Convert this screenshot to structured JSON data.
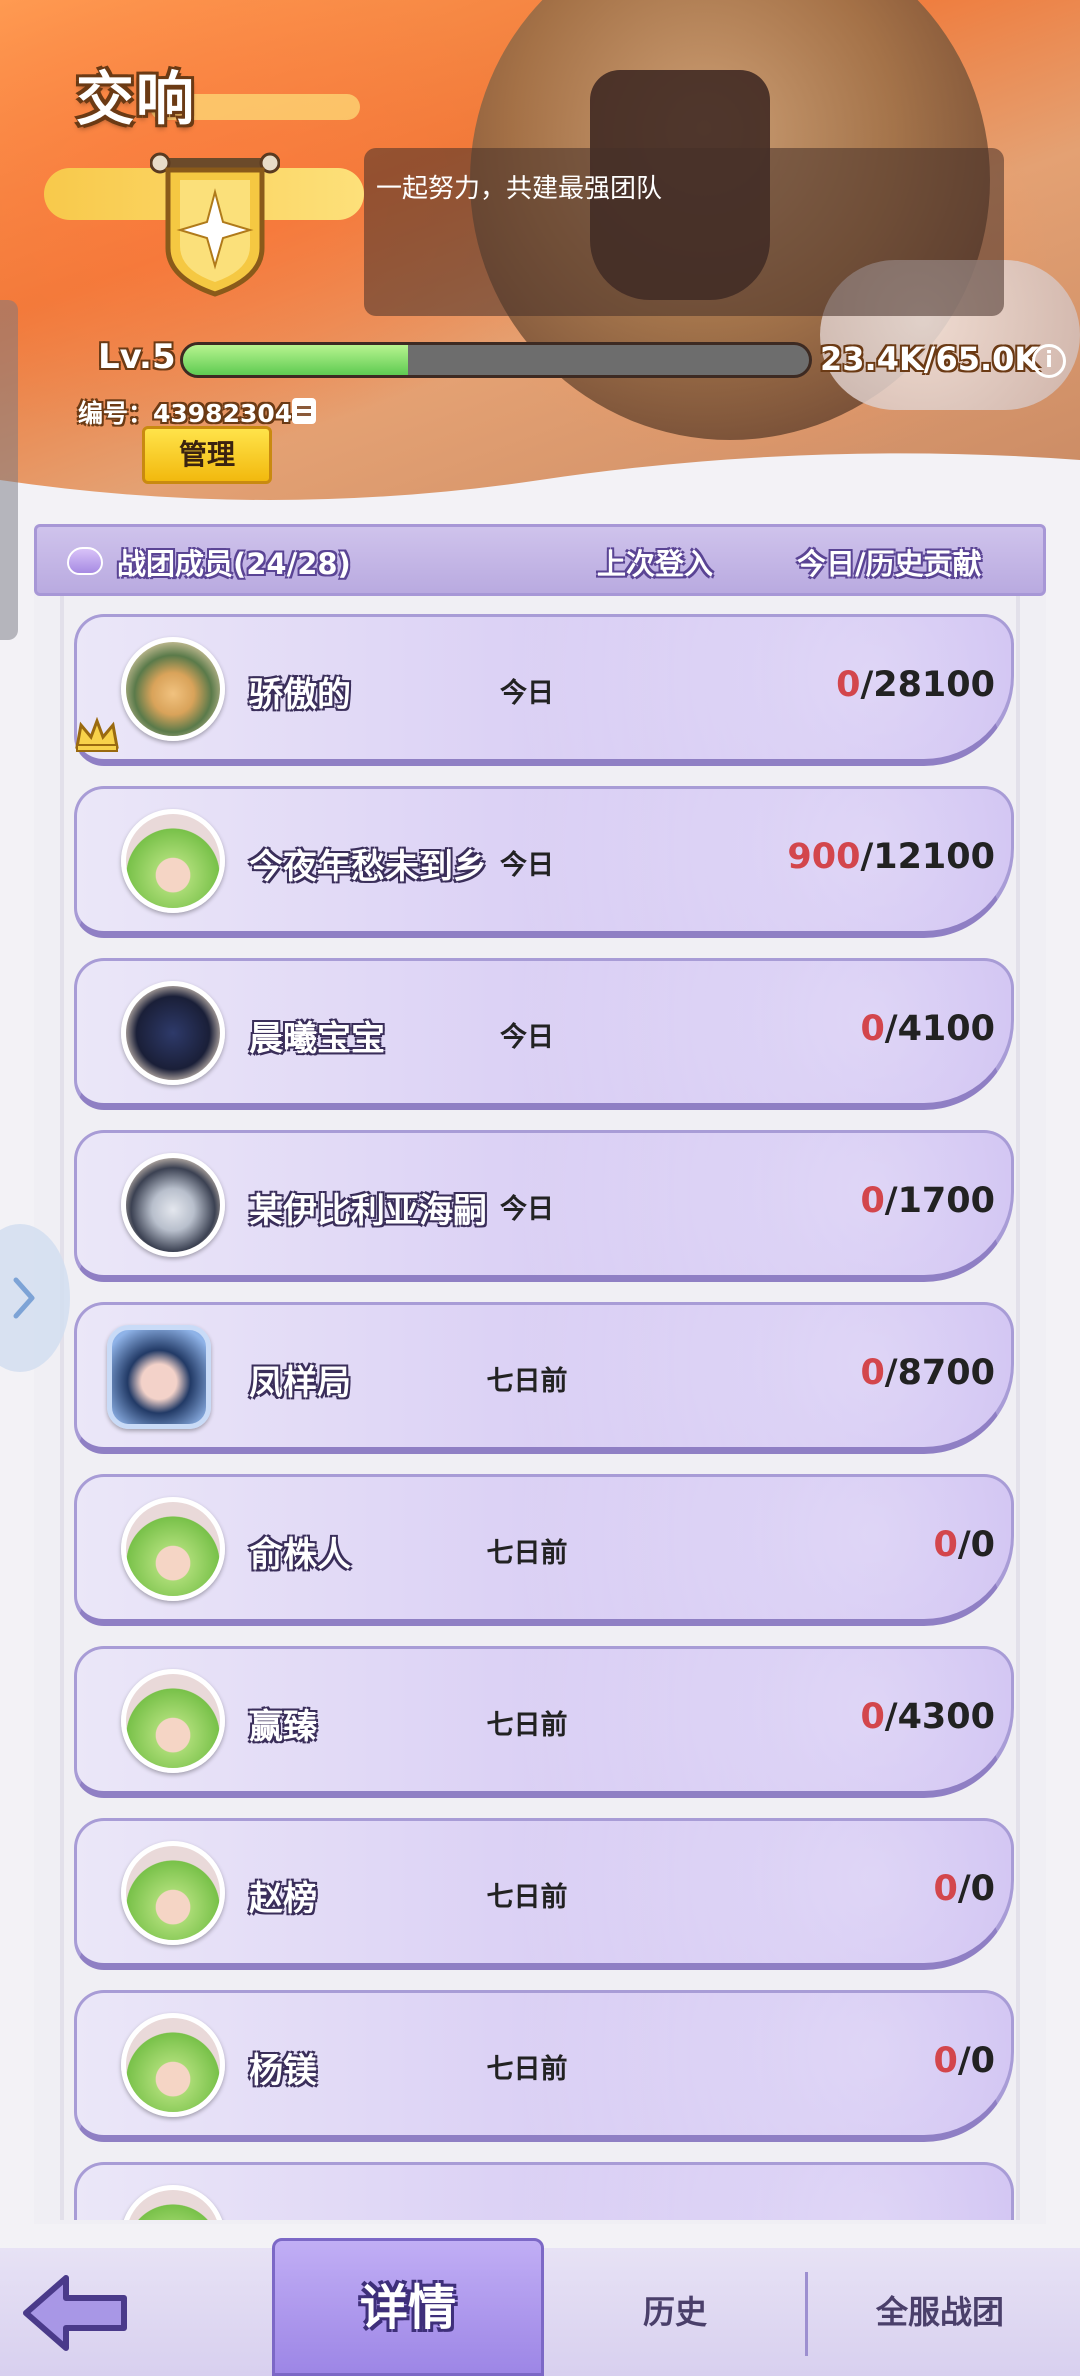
{
  "header": {
    "guild_name": "交响",
    "motto": "一起努力，共建最强团队",
    "level": "Lv.5",
    "progress_text": "23.4K/65.0K",
    "progress_value": 0.36,
    "guild_id": "编号：43982304",
    "manage_label": "管理"
  },
  "members_panel": {
    "title": "战团成员(24/28)",
    "col_last_login": "上次登入",
    "col_contribution": "今日/历史贡献",
    "members": [
      {
        "name": "骄傲的",
        "last_login": "今日",
        "today": "0",
        "total": "/28100",
        "avatar": "knight-avatar",
        "crown": true
      },
      {
        "name": "今夜年愁未到乡",
        "last_login": "今日",
        "today": "900",
        "total": "/12100",
        "avatar": "green-hair-avatar"
      },
      {
        "name": "晨曦宝宝",
        "last_login": "今日",
        "today": "0",
        "total": "/4100",
        "avatar": "robot-avatar"
      },
      {
        "name": "某伊比利亚海嗣",
        "last_login": "今日",
        "today": "0",
        "total": "/1700",
        "avatar": "hooded-avatar"
      },
      {
        "name": "凤样局",
        "last_login": "七日前",
        "today": "0",
        "total": "/8700",
        "avatar": "blue-hair-avatar"
      },
      {
        "name": "俞株人",
        "last_login": "七日前",
        "today": "0",
        "total": "/0",
        "avatar": "green-hair-avatar"
      },
      {
        "name": "赢臻",
        "last_login": "七日前",
        "today": "0",
        "total": "/4300",
        "avatar": "green-hair-avatar"
      },
      {
        "name": "赵榜",
        "last_login": "七日前",
        "today": "0",
        "total": "/0",
        "avatar": "green-hair-avatar"
      },
      {
        "name": "杨镁",
        "last_login": "七日前",
        "today": "0",
        "total": "/0",
        "avatar": "green-hair-avatar"
      }
    ]
  },
  "bottom_nav": {
    "tabs": [
      {
        "label": "详情",
        "active": true
      },
      {
        "label": "历史",
        "active": false
      },
      {
        "label": "全服战团",
        "active": false
      }
    ]
  },
  "colors": {
    "today_contribution": "#d3464c",
    "progress_fill": "#5fcb52",
    "card_purple": "#c8b8f0"
  }
}
